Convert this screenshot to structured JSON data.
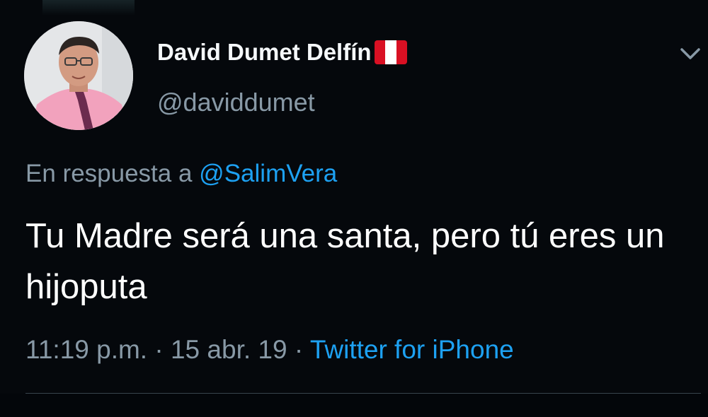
{
  "author": {
    "display_name": "David Dumet Delfín",
    "handle": "@daviddumet",
    "flag_icon": "peru-flag-icon",
    "avatar_icon": "profile-photo-avatar"
  },
  "reply": {
    "prefix": "En respuesta a",
    "mention": "@SalimVera"
  },
  "tweet": {
    "text": "Tu Madre será una santa, pero tú eres un hijoputa"
  },
  "meta": {
    "time": "11:19 p.m.",
    "separator": "·",
    "date": "15 abr. 19",
    "source": "Twitter for iPhone"
  },
  "menu": {
    "icon": "chevron-down-icon"
  },
  "colors": {
    "background": "#05080c",
    "primary_text": "#ffffff",
    "secondary_text": "#8899a6",
    "link": "#1da1f2",
    "flag_red": "#d91023",
    "flag_white": "#ffffff"
  }
}
